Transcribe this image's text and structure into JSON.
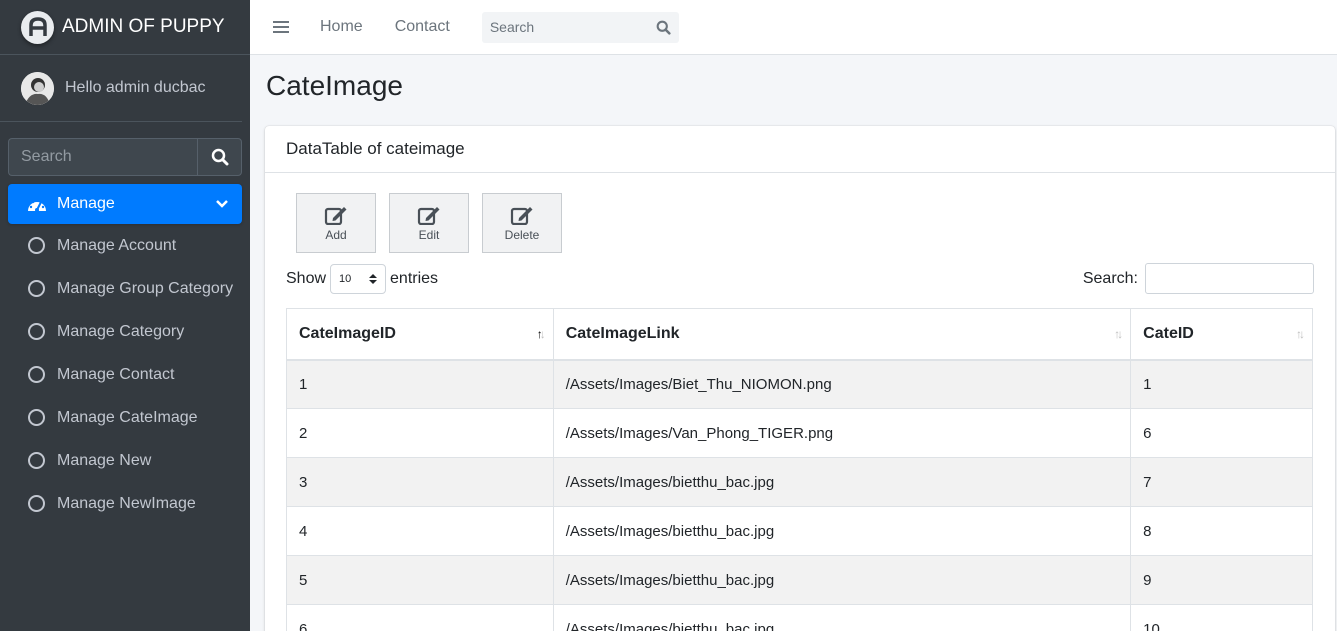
{
  "brand": {
    "title": "ADMIN OF PUPPY"
  },
  "user": {
    "greeting": "Hello admin ducbac"
  },
  "sidebar": {
    "search_placeholder": "Search",
    "active": {
      "label": "Manage"
    },
    "items": [
      {
        "label": "Manage Account"
      },
      {
        "label": "Manage Group Category"
      },
      {
        "label": "Manage Category"
      },
      {
        "label": "Manage Contact"
      },
      {
        "label": "Manage CateImage"
      },
      {
        "label": "Manage New"
      },
      {
        "label": "Manage NewImage"
      }
    ]
  },
  "topbar": {
    "links": [
      {
        "label": "Home"
      },
      {
        "label": "Contact"
      }
    ],
    "search_placeholder": "Search"
  },
  "page": {
    "title": "CateImage"
  },
  "card": {
    "header": "DataTable of cateimage"
  },
  "buttons": [
    {
      "label": "Add"
    },
    {
      "label": "Edit"
    },
    {
      "label": "Delete"
    }
  ],
  "length": {
    "prefix": "Show",
    "value": "10",
    "suffix": "entries"
  },
  "dt_search": {
    "label": "Search:"
  },
  "table": {
    "headers": [
      "CateImageID",
      "CateImageLink",
      "CateID"
    ],
    "rows": [
      [
        "1",
        "/Assets/Images/Biet_Thu_NIOMON.png",
        "1"
      ],
      [
        "2",
        "/Assets/Images/Van_Phong_TIGER.png",
        "6"
      ],
      [
        "3",
        "/Assets/Images/bietthu_bac.jpg",
        "7"
      ],
      [
        "4",
        "/Assets/Images/bietthu_bac.jpg",
        "8"
      ],
      [
        "5",
        "/Assets/Images/bietthu_bac.jpg",
        "9"
      ],
      [
        "6",
        "/Assets/Images/bietthu_bac.jpg",
        "10"
      ]
    ]
  },
  "colors": {
    "sidebar_bg": "#343a40",
    "accent": "#007bff",
    "page_bg": "#f4f6f9"
  }
}
